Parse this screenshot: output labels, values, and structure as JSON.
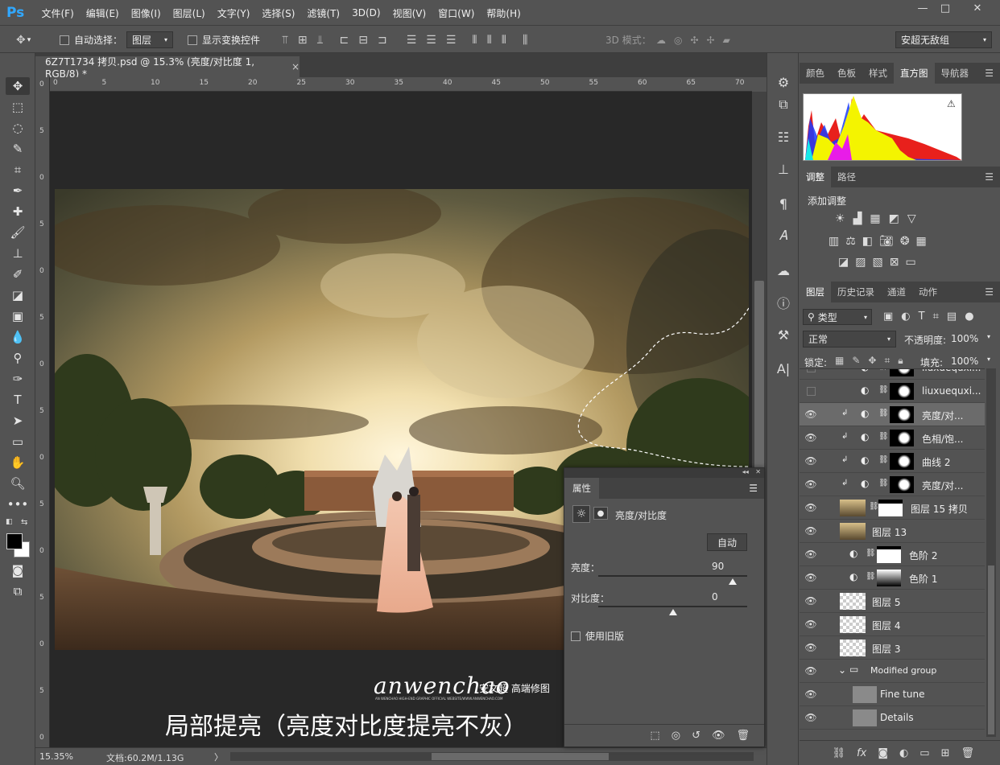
{
  "app": {
    "logo": "Ps"
  },
  "menu": [
    "文件(F)",
    "编辑(E)",
    "图像(I)",
    "图层(L)",
    "文字(Y)",
    "选择(S)",
    "滤镜(T)",
    "3D(D)",
    "视图(V)",
    "窗口(W)",
    "帮助(H)"
  ],
  "window_controls": {
    "minimize": "—",
    "maximize": "□",
    "close": "✕"
  },
  "options": {
    "auto_select_label": "自动选择：",
    "auto_select_target": "图层",
    "show_transform_label": "显示变换控件",
    "mode3d_label": "3D 模式：",
    "workspace": "安超无敌组"
  },
  "document": {
    "tab_title": "6Z7T1734 拷贝.psd @ 15.3% (亮度/对比度 1, RGB/8) *",
    "tab_close": "×"
  },
  "ruler": {
    "h": [
      "0",
      "5",
      "10",
      "15",
      "20",
      "25",
      "30",
      "35",
      "40",
      "45",
      "50",
      "55",
      "60",
      "65",
      "70"
    ],
    "v": [
      "0",
      "5",
      "0",
      "5",
      "0",
      "5",
      "0",
      "5",
      "0",
      "5",
      "0",
      "5",
      "0",
      "5",
      "0"
    ]
  },
  "canvas": {
    "watermark_brand": "anwenchao",
    "watermark_cn": "安文超 高端修图",
    "watermark_sub": "AN WENCHAO HIGH-END GRAPHIC OFFICIAL WEBSITE/WWW.ANWENCHAO.COM",
    "caption": "局部提亮（亮度对比度提亮不灰）"
  },
  "status": {
    "zoom": "15.35%",
    "doc_info": "文档:60.2M/1.13G",
    "arrow": "〉"
  },
  "panels": {
    "top_tabs": [
      "颜色",
      "色板",
      "样式",
      "直方图",
      "导航器"
    ],
    "top_active": "直方图",
    "adj_tabs": [
      "调整",
      "路径"
    ],
    "adj_title": "添加调整",
    "layer_tabs": [
      "图层",
      "历史记录",
      "通道",
      "动作"
    ],
    "filter_kind": "类型",
    "blend_mode": "正常",
    "opacity_label": "不透明度:",
    "opacity_value": "100%",
    "lock_label": "锁定:",
    "fill_label": "填充:",
    "fill_value": "100%"
  },
  "layers": [
    {
      "name": "liuxuequxi...",
      "visible": false,
      "type": "adj",
      "mask": "dark",
      "clip": false
    },
    {
      "name": "liuxuequxi...",
      "visible": false,
      "type": "adj",
      "mask": "dark",
      "clip": false
    },
    {
      "name": "亮度/对...",
      "visible": true,
      "type": "adj",
      "mask": "dark",
      "clip": true,
      "selected": true
    },
    {
      "name": "色相/饱...",
      "visible": true,
      "type": "adj",
      "mask": "dark",
      "clip": true
    },
    {
      "name": "曲线 2",
      "visible": true,
      "type": "adj",
      "mask": "dark",
      "clip": true
    },
    {
      "name": "亮度/对...",
      "visible": true,
      "type": "adj",
      "mask": "dark",
      "clip": true
    },
    {
      "name": "图层 15 拷贝",
      "visible": true,
      "type": "pixel",
      "mask": "light",
      "clip": false
    },
    {
      "name": "图层 13",
      "visible": true,
      "type": "pixel",
      "mask": "none",
      "clip": false
    },
    {
      "name": "色阶 2",
      "visible": true,
      "type": "adj",
      "mask": "light",
      "clip": false
    },
    {
      "name": "色阶 1",
      "visible": true,
      "type": "adj",
      "mask": "grad",
      "clip": false
    },
    {
      "name": "图层 5",
      "visible": true,
      "type": "pixel",
      "mask": "none",
      "clip": false
    },
    {
      "name": "图层 4",
      "visible": true,
      "type": "pixel",
      "mask": "none",
      "clip": false
    },
    {
      "name": "图层 3",
      "visible": true,
      "type": "pixel",
      "mask": "none",
      "clip": false
    },
    {
      "name": "Modified group",
      "visible": true,
      "type": "group",
      "mask": "none",
      "clip": false
    },
    {
      "name": "Fine tune",
      "visible": true,
      "type": "pixel",
      "mask": "none",
      "clip": false
    },
    {
      "name": "Details",
      "visible": true,
      "type": "pixel",
      "mask": "none",
      "clip": false
    }
  ],
  "properties": {
    "title": "属性",
    "adj_name": "亮度/对比度",
    "auto_label": "自动",
    "brightness_label": "亮度：",
    "brightness_value": "90",
    "brightness_level": 0.9,
    "contrast_label": "对比度：",
    "contrast_value": "0",
    "contrast_level": 0.5,
    "legacy_label": "使用旧版"
  },
  "colors": {
    "accent": "#31a8ff",
    "bg": "#535353",
    "dark": "#282828"
  }
}
